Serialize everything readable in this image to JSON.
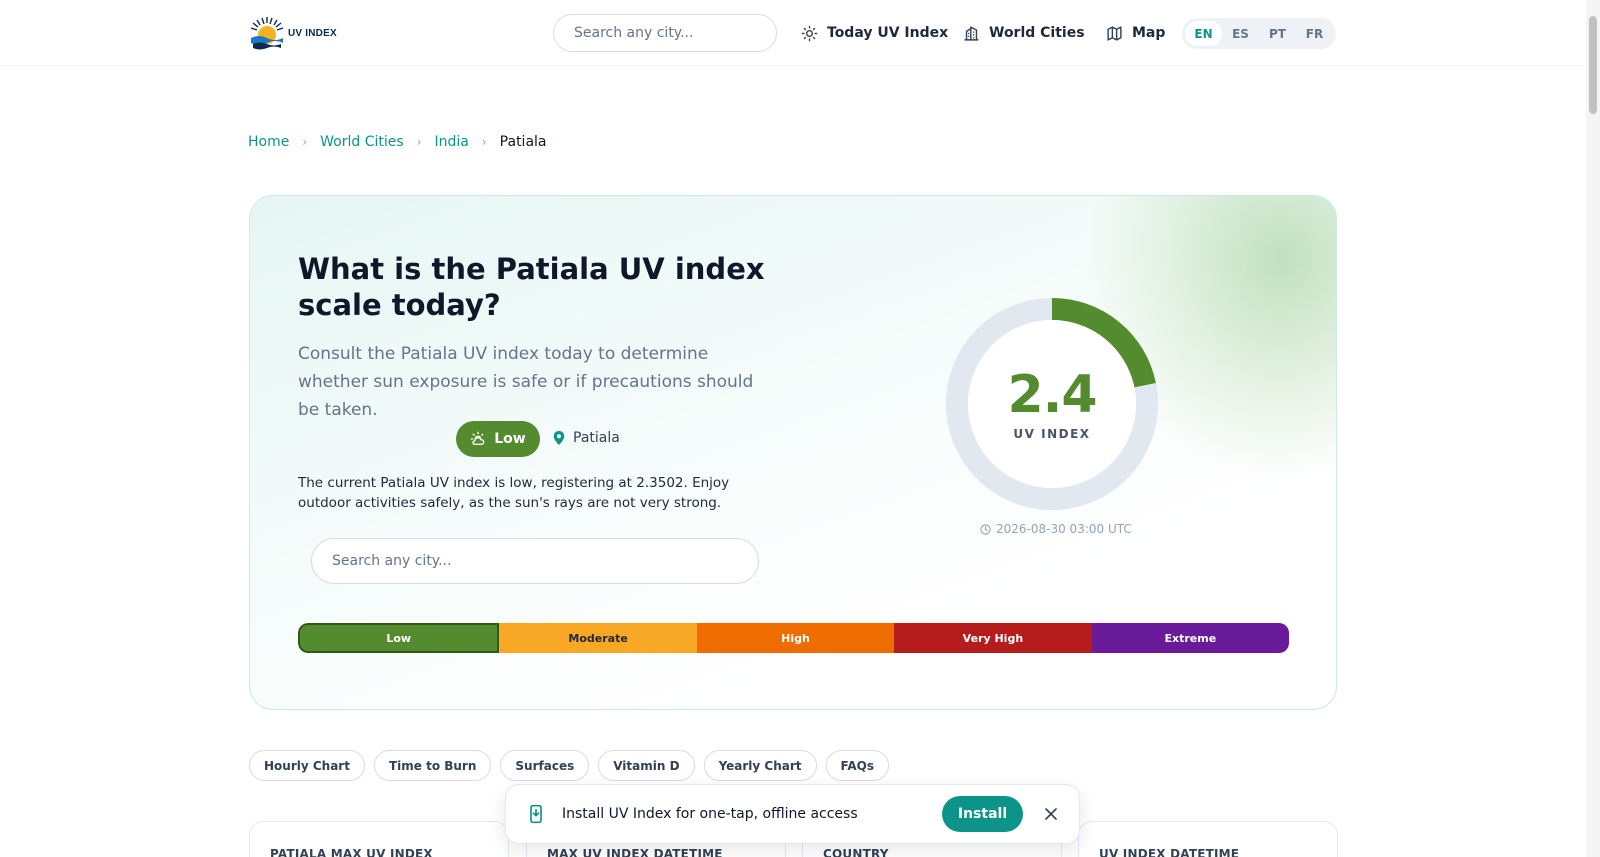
{
  "header": {
    "logo_text": "UV INDEX",
    "search_placeholder": "Search any city...",
    "nav": [
      {
        "label": "Today UV Index",
        "icon": "sun-icon"
      },
      {
        "label": "World Cities",
        "icon": "city-icon"
      },
      {
        "label": "Map",
        "icon": "map-icon"
      }
    ],
    "languages": [
      "EN",
      "ES",
      "PT",
      "FR"
    ],
    "active_language": "EN"
  },
  "breadcrumb": {
    "items": [
      "Home",
      "World Cities",
      "India"
    ],
    "current": "Patiala"
  },
  "hero": {
    "title": "What is the Patiala UV index scale today?",
    "subtitle": "Consult the Patiala UV index today to determine whether sun exposure is safe or if precautions should be taken.",
    "level_label": "Low",
    "location": "Patiala",
    "description": "The current Patiala UV index is low, registering at 2.3502. Enjoy outdoor activities safely, as the sun's rays are not very strong.",
    "search_placeholder": "Search any city...",
    "uv_value": "2.4",
    "uv_label": "UV INDEX",
    "uv_numeric": 2.4,
    "uv_max": 11,
    "timestamp": "2026-08-30 03:00 UTC",
    "scale": [
      "Low",
      "Moderate",
      "High",
      "Very High",
      "Extreme"
    ],
    "colors": {
      "low": "#558b2f",
      "moderate": "#f9a825",
      "high": "#ef6c00",
      "very_high": "#b71c1c",
      "extreme": "#6a1b9a",
      "accent": "#0d9488"
    }
  },
  "pills": [
    "Hourly Chart",
    "Time to Burn",
    "Surfaces",
    "Vitamin D",
    "Yearly Chart",
    "FAQs"
  ],
  "cards": [
    "PATIALA MAX UV INDEX",
    "MAX UV INDEX DATETIME",
    "COUNTRY",
    "UV INDEX DATETIME"
  ],
  "install": {
    "text": "Install UV Index for one-tap, offline access",
    "button": "Install"
  }
}
